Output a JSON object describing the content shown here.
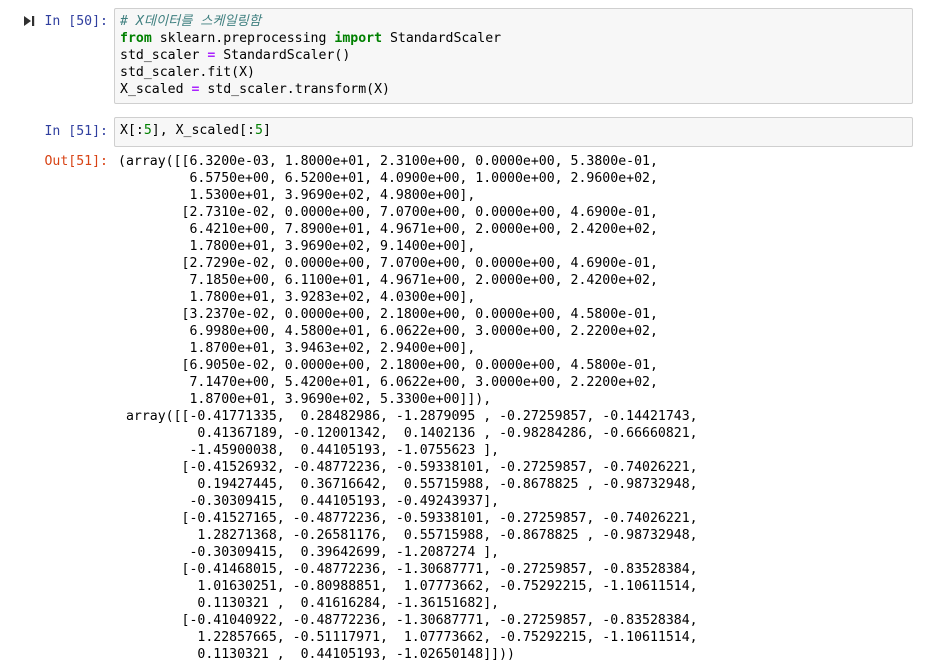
{
  "cells": [
    {
      "prompt": "In [50]:",
      "lines": [
        [
          {
            "t": "# X데이터를 스케일링함",
            "c": "cm"
          }
        ],
        [
          {
            "t": "from",
            "c": "kw"
          },
          {
            "t": " sklearn.preprocessing ",
            "c": ""
          },
          {
            "t": "import",
            "c": "kw"
          },
          {
            "t": " StandardScaler",
            "c": ""
          }
        ],
        [
          {
            "t": "std_scaler ",
            "c": ""
          },
          {
            "t": "=",
            "c": "op"
          },
          {
            "t": " StandardScaler()",
            "c": ""
          }
        ],
        [
          {
            "t": "std_scaler.fit(X)",
            "c": ""
          }
        ],
        [
          {
            "t": "X_scaled ",
            "c": ""
          },
          {
            "t": "=",
            "c": "op"
          },
          {
            "t": " std_scaler.transform(X)",
            "c": ""
          }
        ]
      ]
    },
    {
      "prompt": "In [51]:",
      "lines": [
        [
          {
            "t": "X[:",
            "c": ""
          },
          {
            "t": "5",
            "c": "nm"
          },
          {
            "t": "], X_scaled[:",
            "c": ""
          },
          {
            "t": "5",
            "c": "nm"
          },
          {
            "t": "]",
            "c": ""
          }
        ]
      ]
    }
  ],
  "output": {
    "prompt": "Out[51]:",
    "text": "(array([[6.3200e-03, 1.8000e+01, 2.3100e+00, 0.0000e+00, 5.3800e-01,\n         6.5750e+00, 6.5200e+01, 4.0900e+00, 1.0000e+00, 2.9600e+02,\n         1.5300e+01, 3.9690e+02, 4.9800e+00],\n        [2.7310e-02, 0.0000e+00, 7.0700e+00, 0.0000e+00, 4.6900e-01,\n         6.4210e+00, 7.8900e+01, 4.9671e+00, 2.0000e+00, 2.4200e+02,\n         1.7800e+01, 3.9690e+02, 9.1400e+00],\n        [2.7290e-02, 0.0000e+00, 7.0700e+00, 0.0000e+00, 4.6900e-01,\n         7.1850e+00, 6.1100e+01, 4.9671e+00, 2.0000e+00, 2.4200e+02,\n         1.7800e+01, 3.9283e+02, 4.0300e+00],\n        [3.2370e-02, 0.0000e+00, 2.1800e+00, 0.0000e+00, 4.5800e-01,\n         6.9980e+00, 4.5800e+01, 6.0622e+00, 3.0000e+00, 2.2200e+02,\n         1.8700e+01, 3.9463e+02, 2.9400e+00],\n        [6.9050e-02, 0.0000e+00, 2.1800e+00, 0.0000e+00, 4.5800e-01,\n         7.1470e+00, 5.4200e+01, 6.0622e+00, 3.0000e+00, 2.2200e+02,\n         1.8700e+01, 3.9690e+02, 5.3300e+00]]),\n array([[-0.41771335,  0.28482986, -1.2879095 , -0.27259857, -0.14421743,\n          0.41367189, -0.12001342,  0.1402136 , -0.98284286, -0.66660821,\n         -1.45900038,  0.44105193, -1.0755623 ],\n        [-0.41526932, -0.48772236, -0.59338101, -0.27259857, -0.74026221,\n          0.19427445,  0.36716642,  0.55715988, -0.8678825 , -0.98732948,\n         -0.30309415,  0.44105193, -0.49243937],\n        [-0.41527165, -0.48772236, -0.59338101, -0.27259857, -0.74026221,\n          1.28271368, -0.26581176,  0.55715988, -0.8678825 , -0.98732948,\n         -0.30309415,  0.39642699, -1.2087274 ],\n        [-0.41468015, -0.48772236, -1.30687771, -0.27259857, -0.83528384,\n          1.01630251, -0.80988851,  1.07773662, -0.75292215, -1.10611514,\n          0.1130321 ,  0.41616284, -1.36151682],\n        [-0.41040922, -0.48772236, -1.30687771, -0.27259857, -0.83528384,\n          1.22857665, -0.51117971,  1.07773662, -0.75292215, -1.10611514,\n          0.1130321 ,  0.44105193, -1.02650148]]))"
  },
  "icons": {
    "run": "step-run-icon"
  }
}
